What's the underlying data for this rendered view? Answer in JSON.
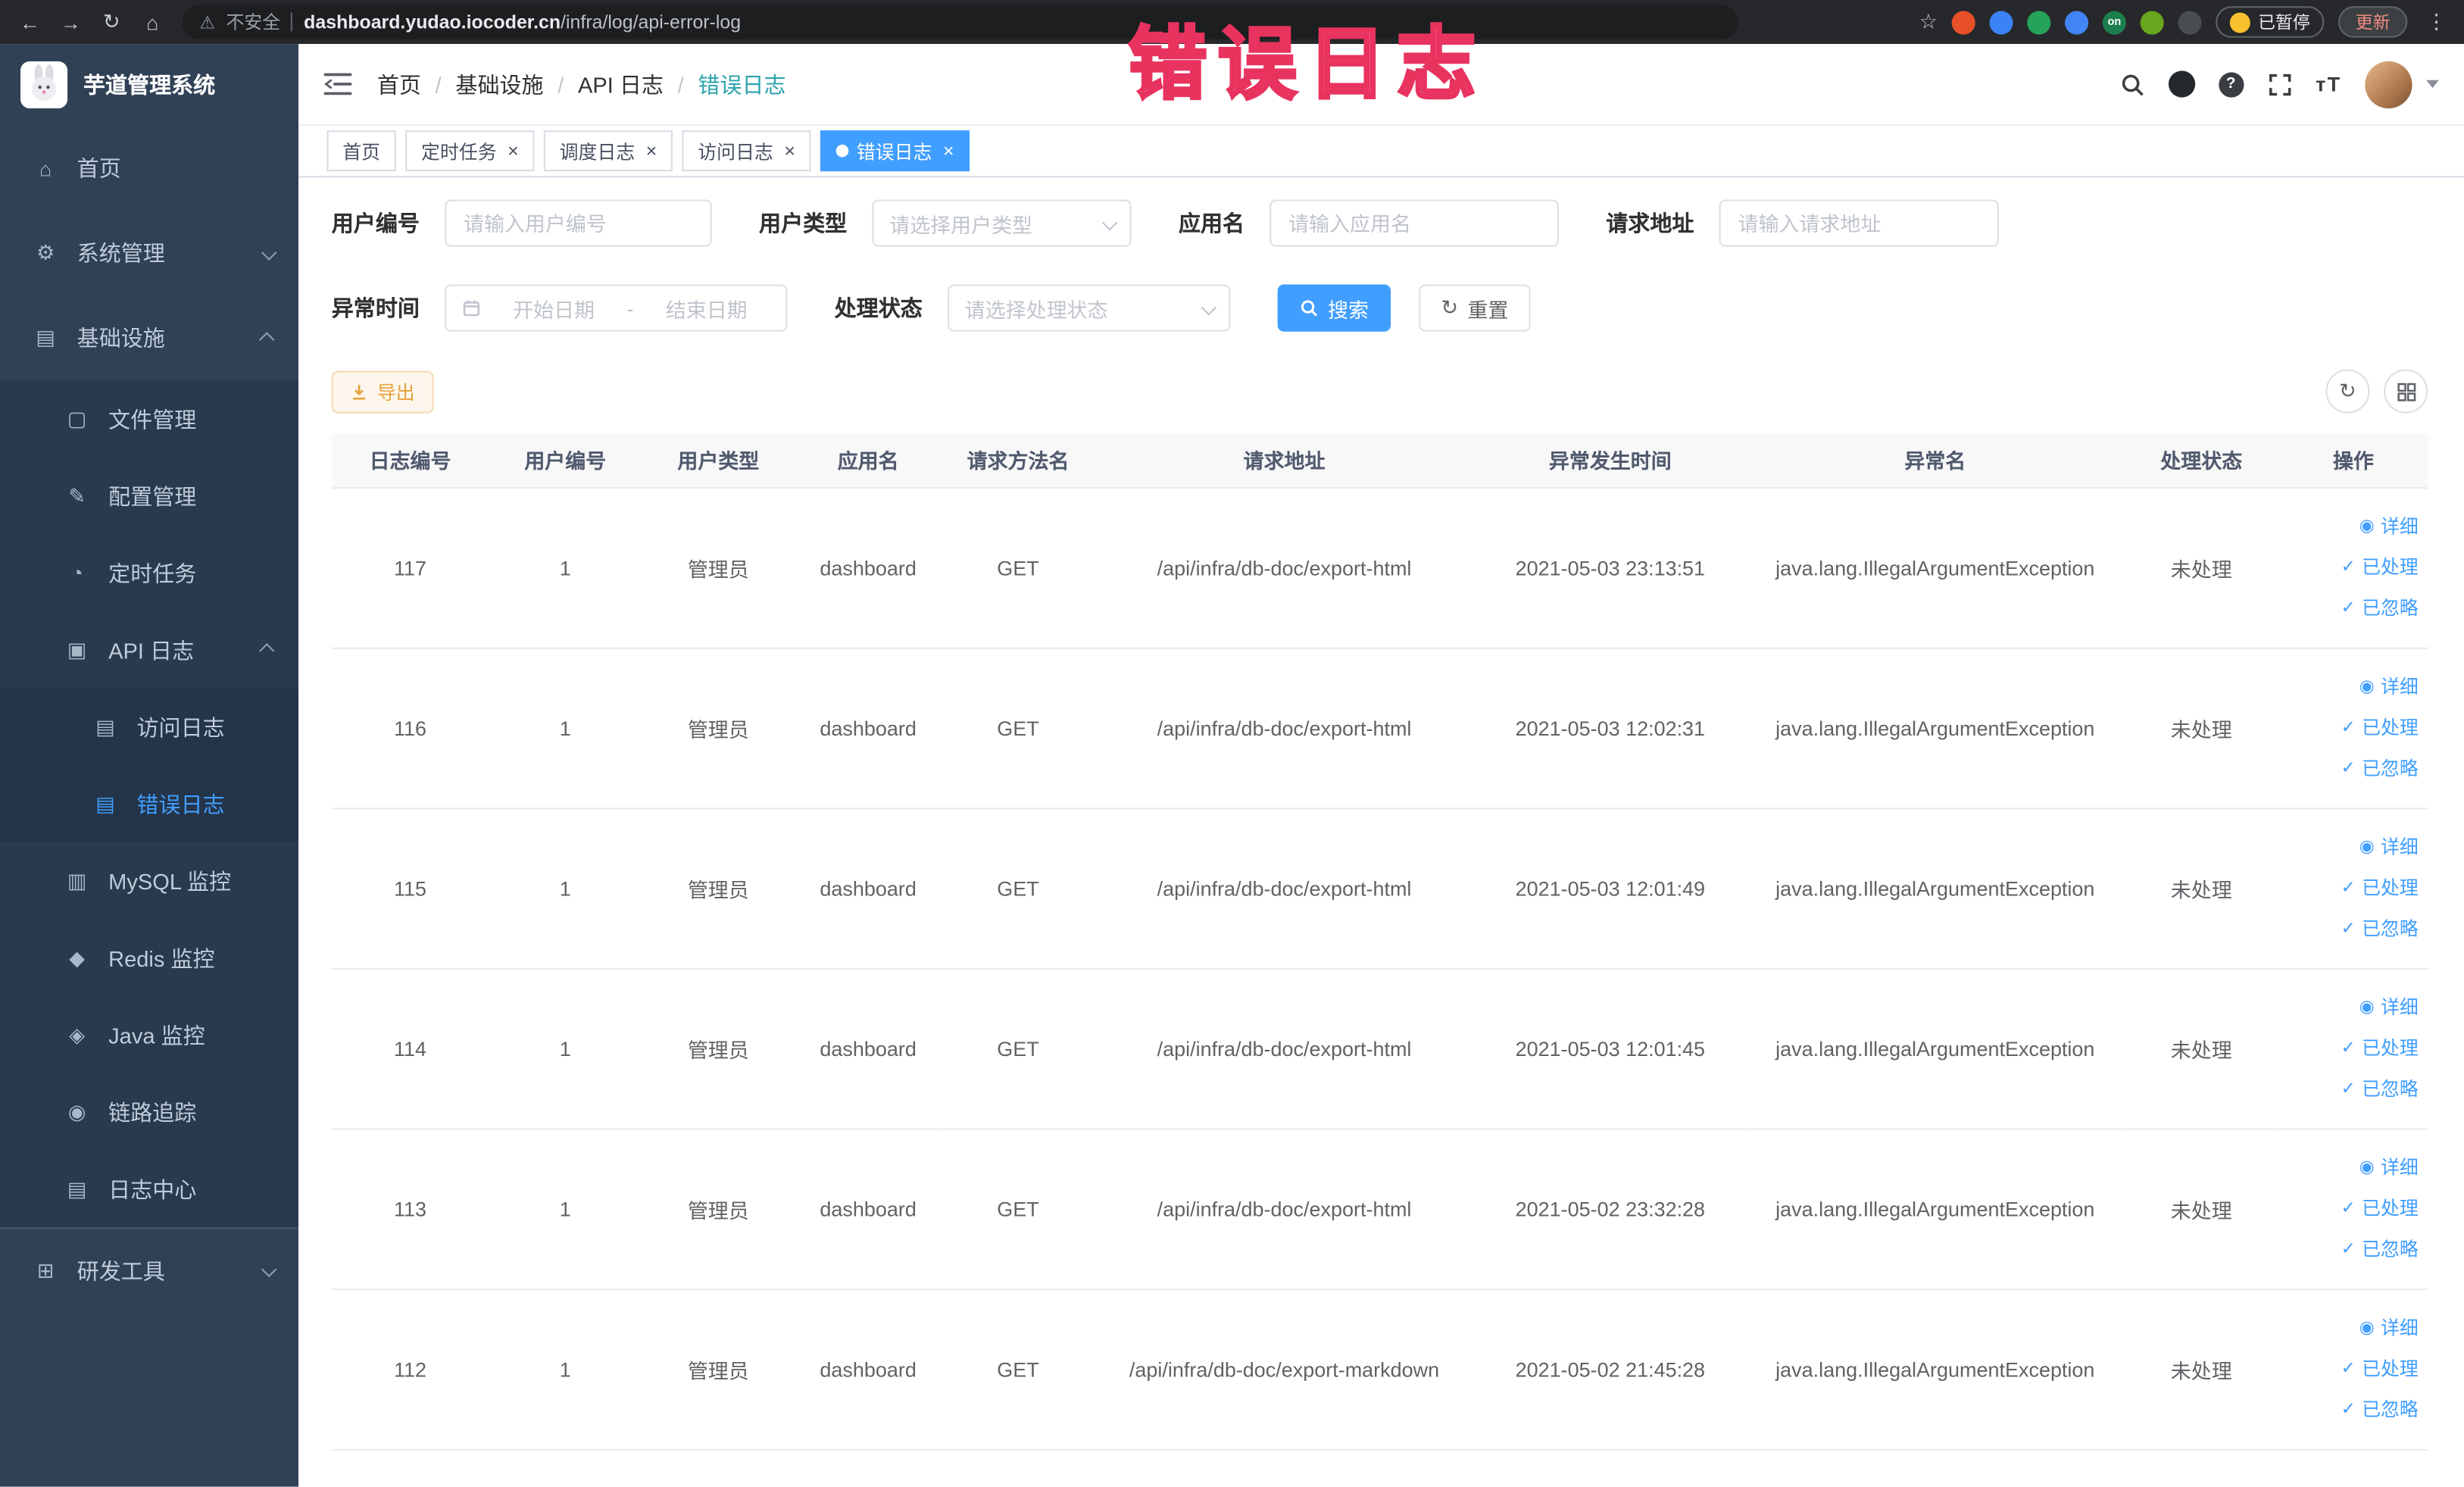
{
  "browser": {
    "security_label": "不安全",
    "url_domain": "dashboard.yudao.iocoder.cn",
    "url_path": "/infra/log/api-error-log",
    "paused_label": "已暂停",
    "update_label": "更新",
    "extensions": [
      {
        "name": "bookmark-star-icon",
        "glyph": "☆",
        "color": ""
      },
      {
        "name": "extension-red-icon",
        "color": "#e8502a",
        "label": ""
      },
      {
        "name": "extension-blue-drop-icon",
        "color": "#3b82f6",
        "label": ""
      },
      {
        "name": "extension-green-icon",
        "color": "#25a35a",
        "label": ""
      },
      {
        "name": "extension-grid-icon",
        "color": "#4285f4",
        "label": ""
      },
      {
        "name": "extension-on-badge-icon",
        "color": "#1b7f4d",
        "label": "on"
      },
      {
        "name": "extension-leaf-icon",
        "color": "#6aa51e",
        "label": ""
      },
      {
        "name": "extension-pin-icon",
        "color": "#4a4d51",
        "label": ""
      }
    ]
  },
  "sidebar": {
    "app_title": "芋道管理系统",
    "items": [
      {
        "label": "首页",
        "icon": "home-icon",
        "level": 0
      },
      {
        "label": "系统管理",
        "icon": "gear-icon",
        "level": 0,
        "chevron": "down"
      },
      {
        "label": "基础设施",
        "icon": "infra-icon",
        "level": 0,
        "chevron": "up"
      },
      {
        "label": "文件管理",
        "icon": "folder-icon",
        "level": 1
      },
      {
        "label": "配置管理",
        "icon": "config-icon",
        "level": 1
      },
      {
        "label": "定时任务",
        "icon": "timer-icon",
        "level": 1
      },
      {
        "label": "API 日志",
        "icon": "api-log-icon",
        "level": 1,
        "chevron": "up"
      },
      {
        "label": "访问日志",
        "icon": "doc-icon",
        "level": 2
      },
      {
        "label": "错误日志",
        "icon": "doc-icon",
        "level": 2,
        "active": true
      },
      {
        "label": "MySQL 监控",
        "icon": "mysql-icon",
        "level": 1
      },
      {
        "label": "Redis 监控",
        "icon": "redis-icon",
        "level": 1
      },
      {
        "label": "Java 监控",
        "icon": "java-icon",
        "level": 1
      },
      {
        "label": "链路追踪",
        "icon": "trace-icon",
        "level": 1
      },
      {
        "label": "日志中心",
        "icon": "log-center-icon",
        "level": 1
      },
      {
        "label": "研发工具",
        "icon": "tools-icon",
        "level": 0,
        "chevron": "down",
        "separated": true
      }
    ]
  },
  "header": {
    "breadcrumb": [
      "首页",
      "基础设施",
      "API 日志",
      "错误日志"
    ],
    "fontsize_icon_glyph": "тT"
  },
  "tabs": [
    {
      "label": "首页",
      "closable": false,
      "active": false
    },
    {
      "label": "定时任务",
      "closable": true,
      "active": false
    },
    {
      "label": "调度日志",
      "closable": true,
      "active": false
    },
    {
      "label": "访问日志",
      "closable": true,
      "active": false
    },
    {
      "label": "错误日志",
      "closable": true,
      "active": true
    }
  ],
  "annotation": {
    "text": "错误日志"
  },
  "filters": {
    "user_id": {
      "label": "用户编号",
      "placeholder": "请输入用户编号"
    },
    "user_type": {
      "label": "用户类型",
      "placeholder": "请选择用户类型"
    },
    "app_name": {
      "label": "应用名",
      "placeholder": "请输入应用名"
    },
    "request_url": {
      "label": "请求地址",
      "placeholder": "请输入请求地址"
    },
    "exception_time": {
      "label": "异常时间",
      "start_placeholder": "开始日期",
      "separator": "-",
      "end_placeholder": "结束日期"
    },
    "process_status": {
      "label": "处理状态",
      "placeholder": "请选择处理状态"
    },
    "search_label": "搜索",
    "reset_label": "重置"
  },
  "toolbar": {
    "export_label": "导出"
  },
  "table": {
    "columns": [
      "日志编号",
      "用户编号",
      "用户类型",
      "应用名",
      "请求方法名",
      "请求地址",
      "异常发生时间",
      "异常名",
      "处理状态",
      "操作"
    ],
    "row_actions": [
      {
        "icon": "eye-icon",
        "label": "详细"
      },
      {
        "icon": "check-icon",
        "label": "已处理"
      },
      {
        "icon": "check-icon",
        "label": "已忽略"
      }
    ],
    "rows": [
      [
        "117",
        "1",
        "管理员",
        "dashboard",
        "GET",
        "/api/infra/db-doc/export-html",
        "2021-05-03 23:13:51",
        "java.lang.IllegalArgumentException",
        "未处理"
      ],
      [
        "116",
        "1",
        "管理员",
        "dashboard",
        "GET",
        "/api/infra/db-doc/export-html",
        "2021-05-03 12:02:31",
        "java.lang.IllegalArgumentException",
        "未处理"
      ],
      [
        "115",
        "1",
        "管理员",
        "dashboard",
        "GET",
        "/api/infra/db-doc/export-html",
        "2021-05-03 12:01:49",
        "java.lang.IllegalArgumentException",
        "未处理"
      ],
      [
        "114",
        "1",
        "管理员",
        "dashboard",
        "GET",
        "/api/infra/db-doc/export-html",
        "2021-05-03 12:01:45",
        "java.lang.IllegalArgumentException",
        "未处理"
      ],
      [
        "113",
        "1",
        "管理员",
        "dashboard",
        "GET",
        "/api/infra/db-doc/export-html",
        "2021-05-02 23:32:28",
        "java.lang.IllegalArgumentException",
        "未处理"
      ],
      [
        "112",
        "1",
        "管理员",
        "dashboard",
        "GET",
        "/api/infra/db-doc/export-markdown",
        "2021-05-02 21:45:28",
        "java.lang.IllegalArgumentException",
        "未处理"
      ]
    ]
  },
  "colors": {
    "accent": "#409eff",
    "warning": "#e6a23c",
    "annotation": "#f0486f",
    "sidebar_bg": "#304156",
    "submenu_bg": "#243449"
  }
}
